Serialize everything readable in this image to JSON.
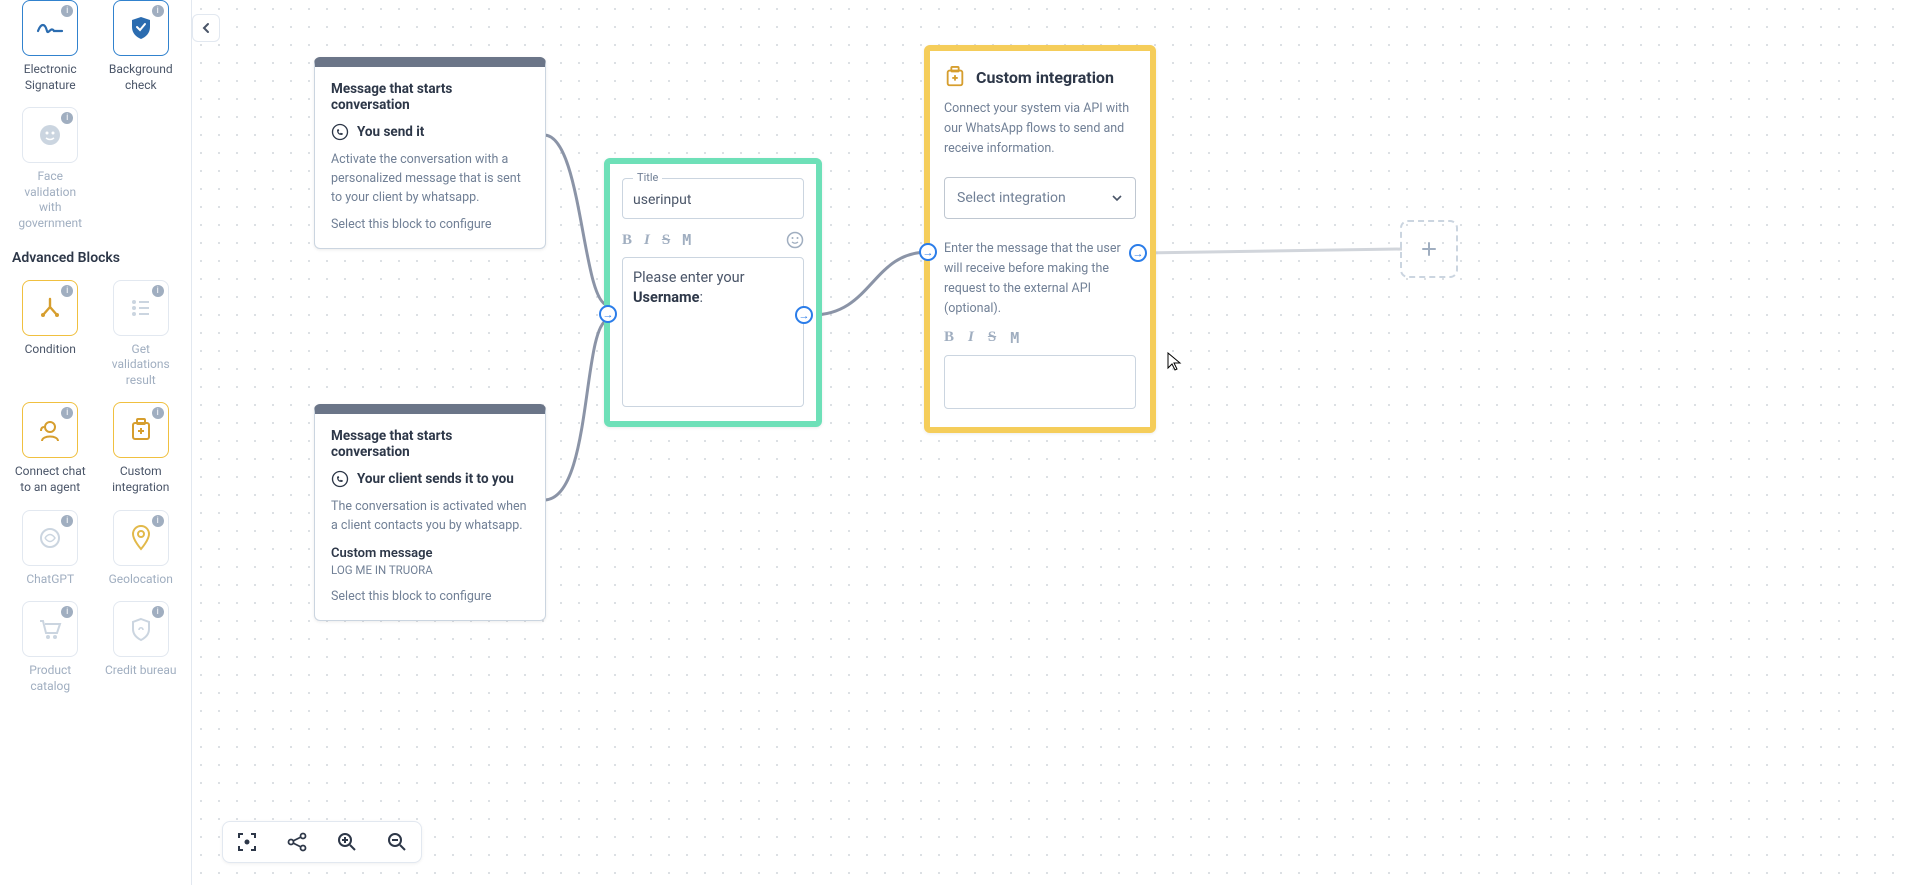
{
  "sidebar": {
    "top_blocks": [
      {
        "label": "Electronic Signature",
        "icon": "signature-icon",
        "muted": false
      },
      {
        "label": "Background check",
        "icon": "shield-icon",
        "muted": false
      },
      {
        "label": "Face validation with government",
        "icon": "face-icon",
        "muted": true
      }
    ],
    "section_title": "Advanced Blocks",
    "adv_blocks": [
      {
        "label": "Condition",
        "icon": "condition-icon",
        "style": "yellow",
        "muted": false
      },
      {
        "label": "Get validations result",
        "icon": "list-icon",
        "style": "gray",
        "muted": true
      },
      {
        "label": "Connect chat to an agent",
        "icon": "agent-icon",
        "style": "yellow",
        "muted": false
      },
      {
        "label": "Custom integration",
        "icon": "integration-icon",
        "style": "yellow",
        "muted": false
      },
      {
        "label": "ChatGPT",
        "icon": "chatgpt-icon",
        "style": "gray",
        "muted": true
      },
      {
        "label": "Geolocation",
        "icon": "pin-icon",
        "style": "gray",
        "muted": true
      },
      {
        "label": "Product catalog",
        "icon": "cart-icon",
        "style": "gray",
        "muted": true
      },
      {
        "label": "Credit bureau",
        "icon": "bureau-icon",
        "style": "gray",
        "muted": true
      }
    ]
  },
  "canvas": {
    "card1": {
      "title": "Message that starts conversation",
      "subline": "You send it",
      "desc": "Activate the conversation with a personalized message that is sent to your client by whatsapp.",
      "hint": "Select this block to configure"
    },
    "card2": {
      "title": "Message that starts conversation",
      "subline": "Your client sends it to you",
      "desc": "The conversation is activated when a client contacts you by whatsapp.",
      "custom_label": "Custom message",
      "custom_value": "LOG ME IN TRUORA",
      "hint": "Select this block to configure"
    },
    "green": {
      "title_label": "Title",
      "title_value": "userinput",
      "message_pre": "Please enter your ",
      "message_bold": "Username",
      "message_post": ":"
    },
    "yellow": {
      "title": "Custom integration",
      "desc": "Connect your system via API with our WhatsApp flows to send and receive information.",
      "select_placeholder": "Select integration",
      "desc2": "Enter the message that the user will receive before making the request to the external API (optional)."
    }
  },
  "toolbar": {
    "fit": "fit-screen",
    "share": "share",
    "zoom_in": "+",
    "zoom_out": "−"
  }
}
